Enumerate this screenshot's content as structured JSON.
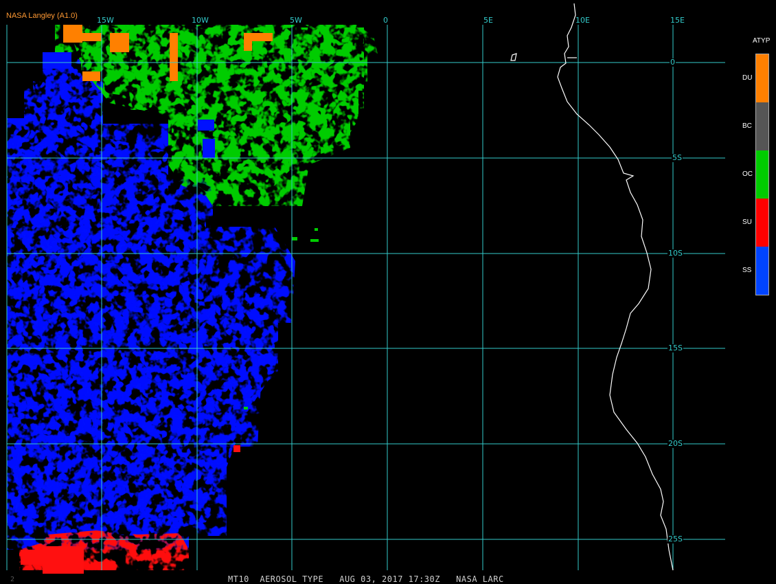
{
  "header": {
    "agency": "NASA Langley (A1.0)"
  },
  "footer": {
    "frame": "2",
    "text": "MT10  AEROSOL TYPE   AUG 03, 2017 17:30Z   NASA LARC"
  },
  "longitude_labels": [
    "15W",
    "10W",
    "5W",
    "0",
    "5E",
    "10E",
    "15E"
  ],
  "latitude_labels": [
    "0",
    "5S",
    "10S",
    "15S",
    "20S",
    "25S"
  ],
  "legend": {
    "title": "ATYP",
    "items": [
      {
        "label": "DU",
        "color": "#ff8000"
      },
      {
        "label": "BC",
        "color": "#555555"
      },
      {
        "label": "OC",
        "color": "#00cc00"
      },
      {
        "label": "SU",
        "color": "#ff0000"
      },
      {
        "label": "SS",
        "color": "#0044ff"
      }
    ]
  },
  "colors": {
    "grid": "#33cccc",
    "coast": "#ffffff",
    "background": "#000000"
  }
}
